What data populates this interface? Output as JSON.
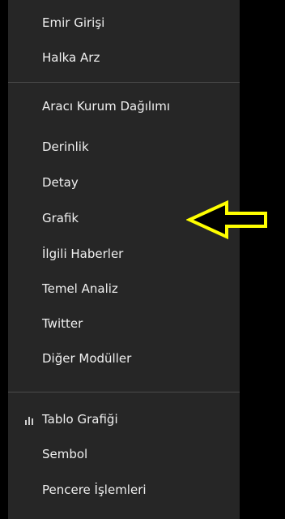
{
  "menu": {
    "items": [
      {
        "label": "Emir Girişi"
      },
      {
        "label": "Halka Arz"
      },
      {
        "label": "Aracı Kurum Dağılımı"
      },
      {
        "label": "Derinlik"
      },
      {
        "label": "Detay"
      },
      {
        "label": "Grafik"
      },
      {
        "label": "İlgili Haberler"
      },
      {
        "label": "Temel Analiz"
      },
      {
        "label": "Twitter"
      },
      {
        "label": "Diğer Modüller"
      },
      {
        "label": "Tablo Grafiği",
        "icon": "bar-chart-icon"
      },
      {
        "label": "Sembol"
      },
      {
        "label": "Pencere İşlemleri"
      }
    ]
  },
  "annotation": {
    "icon": "left-arrow-icon",
    "color": "#ffff00",
    "target": "Grafik"
  },
  "colors": {
    "menu_background": "#262626",
    "page_background": "#000000",
    "text": "#f0f0f0",
    "divider": "#4a4a4a"
  }
}
